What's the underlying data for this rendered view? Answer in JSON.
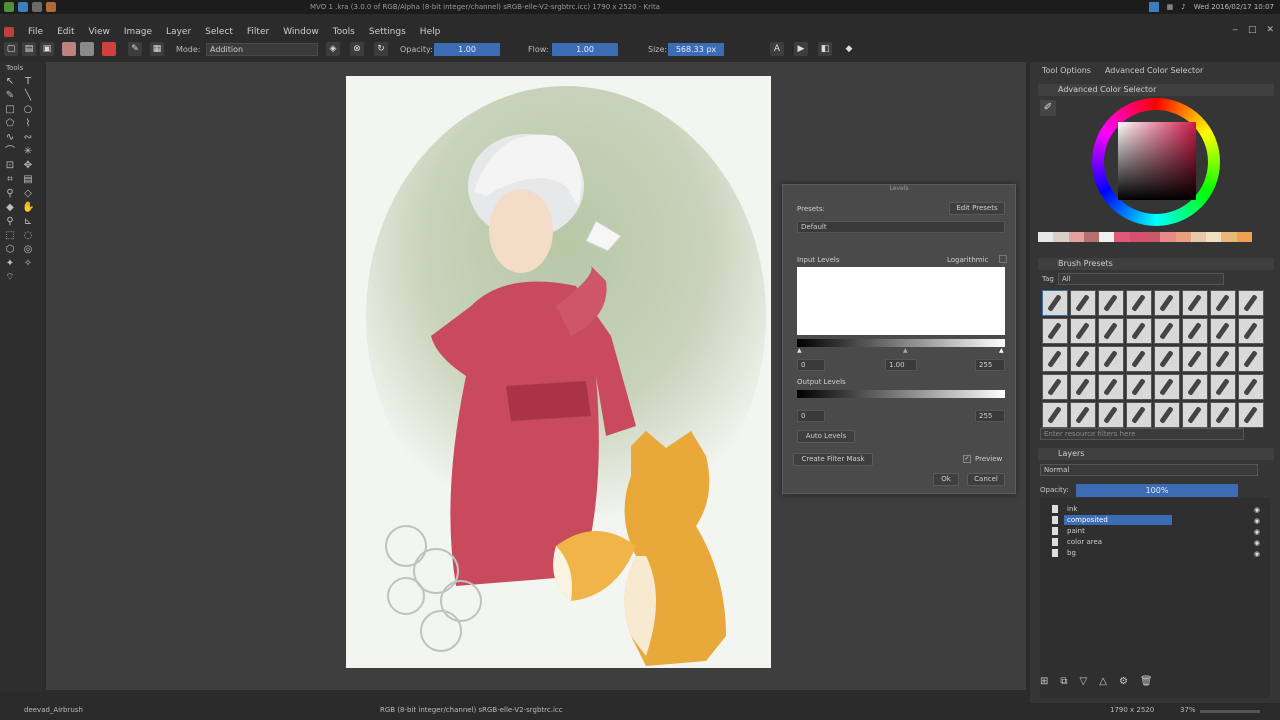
{
  "window": {
    "title": "MVO 1 .kra (3.0.0 of RGB/Alpha (8-bit integer/channel) sRGB-elle-V2-srgbtrc.icc) 1790 x 2520 - Krita"
  },
  "system_tray": {
    "clock": "Wed 2016/02/17 10:07"
  },
  "menu": [
    "File",
    "Edit",
    "View",
    "Image",
    "Layer",
    "Select",
    "Filter",
    "Window",
    "Tools",
    "Settings",
    "Help"
  ],
  "toolbar": {
    "blend_mode_label": "Mode:",
    "blend_mode_value": "Addition",
    "opacity_label": "Opacity:",
    "opacity_value": "1.00",
    "flow_label": "Flow:",
    "flow_value": "1.00",
    "size_label": "Size:",
    "size_value": "568.33 px"
  },
  "toolbox": {
    "title": "Tools"
  },
  "dialog": {
    "title": "Levels",
    "presets_label": "Presets:",
    "edit_presets": "Edit Presets",
    "preset_value": "Default",
    "input_levels_label": "Input Levels",
    "logarithmic_label": "Logarithmic",
    "input_black": "0",
    "input_gamma": "1.00",
    "input_white": "255",
    "output_levels_label": "Output Levels",
    "output_black": "0",
    "output_white": "255",
    "auto_levels": "Auto Levels",
    "create_filter_mask": "Create Filter Mask",
    "preview_label": "Preview",
    "ok": "Ok",
    "cancel": "Cancel",
    "accent": "#3b6cb4"
  },
  "dock": {
    "tabs": [
      "Tool Options",
      "Advanced Color Selector"
    ],
    "color_selector_title": "Advanced Color Selector",
    "swatch_colors": [
      "#e8e8e8",
      "#d8d0c8",
      "#e6a0a0",
      "#b76e6e",
      "#f0f0f0",
      "#e0587a",
      "#d85070",
      "#c85868",
      "#e88888",
      "#e8a080",
      "#e8c8a8",
      "#f0e0c0",
      "#e8b878",
      "#f0a050"
    ],
    "brush_presets_title": "Brush Presets",
    "brush_tag_label": "Tag",
    "brush_tag_value": "All",
    "brush_search_placeholder": "Enter resource filters here",
    "layers_title": "Layers",
    "layer_blend_mode": "Normal",
    "layer_opacity_label": "Opacity:",
    "layer_opacity_value": "100%",
    "layers": [
      {
        "name": "ink",
        "selected": false
      },
      {
        "name": "composited",
        "selected": true
      },
      {
        "name": "paint",
        "selected": false
      },
      {
        "name": "color area",
        "selected": false
      },
      {
        "name": "bg",
        "selected": false
      }
    ]
  },
  "status": {
    "brush": "deevad_Airbrush",
    "color_info": "RGB (8-bit integer/channel) sRGB-elle-V2-srgbtrc.icc",
    "dimensions": "1790 x 2520",
    "zoom": "37%"
  }
}
